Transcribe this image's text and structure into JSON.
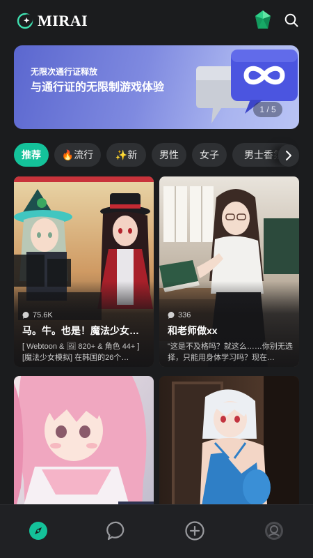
{
  "app": {
    "name": "MIRAI",
    "logo_icon": "crescent-moon-sparkle-logo",
    "brand_color": "#14c29a"
  },
  "header": {
    "gem_icon": "green-gem-icon",
    "search_icon": "search-icon"
  },
  "banner": {
    "subtitle": "无限次通行证释放",
    "title": "与通行证的无限制游戏体验",
    "page_indicator": "1 / 5",
    "art": "speech-bubble-infinity-art"
  },
  "tabs": [
    {
      "label": "推荐",
      "active": true
    },
    {
      "label": "🔥流行",
      "active": false
    },
    {
      "label": "✨新",
      "active": false
    },
    {
      "label": "男性",
      "active": false
    },
    {
      "label": "女子",
      "active": false
    },
    {
      "label": "男士香氛",
      "active": false
    }
  ],
  "cards": [
    {
      "views": "75.6K",
      "title": "马。牛。也是！魔法少女…",
      "description": "[ Webtoon & 🖼 820+ & 角色 44+ ] [魔法少女模拟] 在韩国的26个…",
      "art": "magic-girls-comic-art"
    },
    {
      "views": "336",
      "title": "和老师做xx",
      "description": "\"这是不及格吗？就这么……你别无选择，只能用身体学习吗？现在…",
      "art": "classroom-teacher-art"
    },
    {
      "views": "",
      "title": "",
      "description": "",
      "art": "pink-hair-girl-art"
    },
    {
      "views": "",
      "title": "",
      "description": "",
      "art": "white-hair-girl-art"
    }
  ],
  "bottom_nav": [
    {
      "icon": "compass-icon",
      "active": true
    },
    {
      "icon": "chat-bubble-icon",
      "active": false
    },
    {
      "icon": "plus-circle-icon",
      "active": false
    },
    {
      "icon": "profile-icon",
      "active": false
    }
  ]
}
